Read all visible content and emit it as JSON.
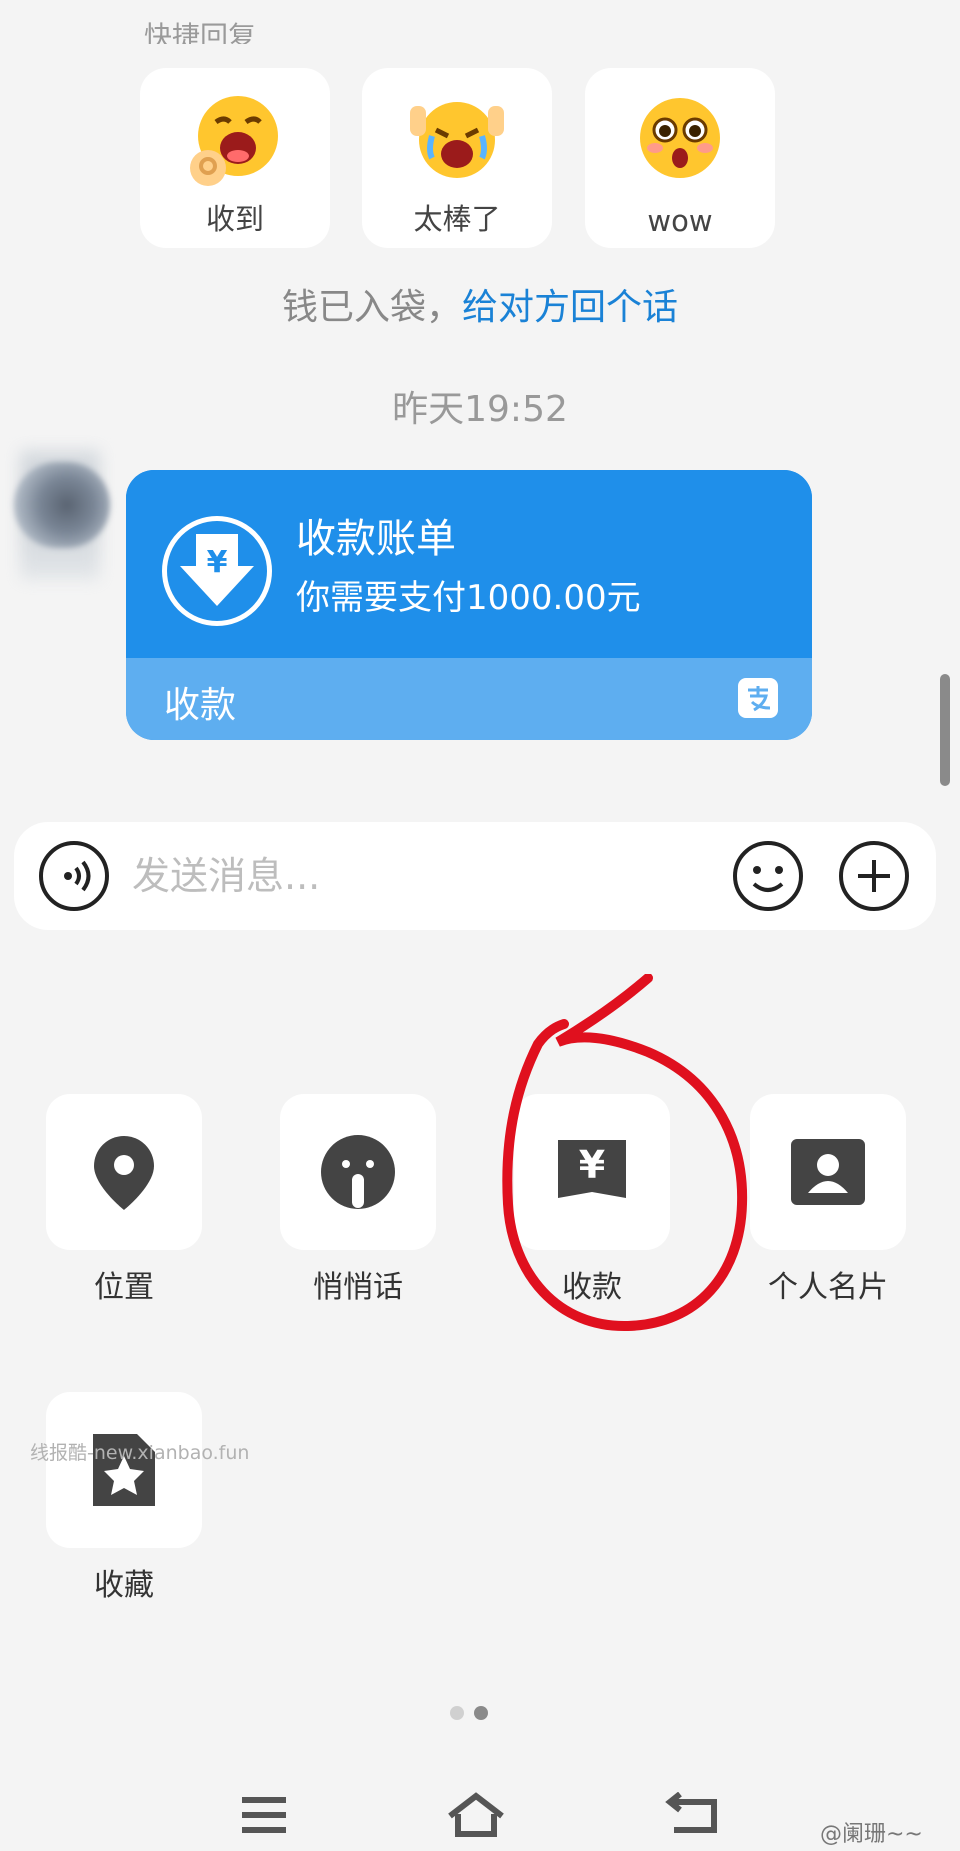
{
  "quick_reply": {
    "header": "快捷回复",
    "items": [
      {
        "label": "收到"
      },
      {
        "label": "太棒了"
      },
      {
        "label": "wow"
      }
    ]
  },
  "notice": {
    "text": "钱已入袋，",
    "link": "给对方回个话"
  },
  "timestamp": "昨天19:52",
  "payment_card": {
    "title": "收款账单",
    "amount_text": "你需要支付1000.00元",
    "footer_label": "收款",
    "currency_symbol": "¥"
  },
  "composer": {
    "placeholder": "发送消息..."
  },
  "functions": [
    {
      "label": "位置"
    },
    {
      "label": "悄悄话"
    },
    {
      "label": "收款"
    },
    {
      "label": "个人名片"
    },
    {
      "label": "收藏"
    }
  ],
  "pagination": {
    "total": 2,
    "current": 2
  },
  "watermark": "线报酷-new.xianbao.fun",
  "weibo_mark": "@阑珊~~",
  "colors": {
    "accent_blue": "#1f8fea",
    "card_footer_blue": "#5eaef0",
    "link_blue": "#1a82d6",
    "annotation_red": "#e0101e"
  }
}
